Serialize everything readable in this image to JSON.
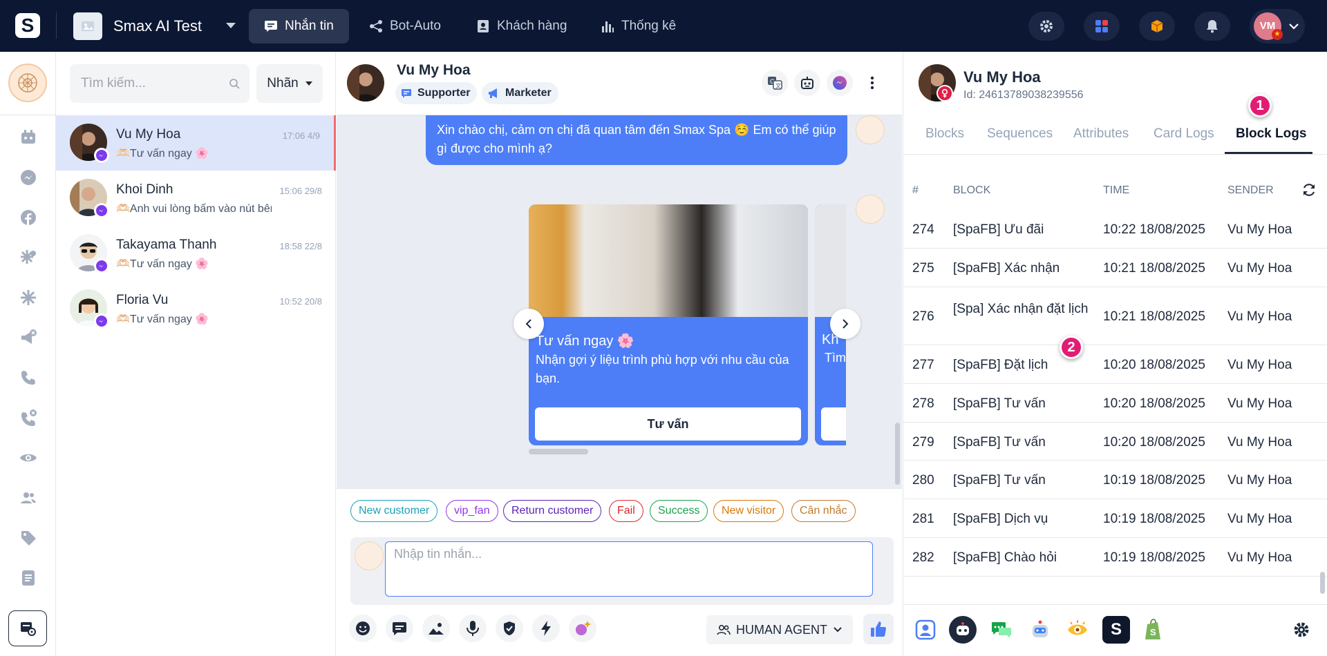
{
  "topbar": {
    "logo": "S",
    "workspace_name": "Smax AI Test",
    "tabs": [
      {
        "label": "Nhắn tin",
        "icon": "chat-icon",
        "active": true
      },
      {
        "label": "Bot-Auto",
        "icon": "bot-flow-icon",
        "active": false
      },
      {
        "label": "Khách hàng",
        "icon": "contact-icon",
        "active": false
      },
      {
        "label": "Thống kê",
        "icon": "stats-icon",
        "active": false
      }
    ],
    "avatar_initials": "VM",
    "flag_star": "★"
  },
  "left_rail": {
    "icons": [
      "bot-calendar-icon",
      "messenger-icon",
      "facebook-icon",
      "zalo-icon",
      "spark-icon",
      "megaphone-icon",
      "phone-icon",
      "phone-missed-icon",
      "eye-icon",
      "users-icon",
      "tag-icon",
      "document-icon",
      "workspace-settings-icon"
    ]
  },
  "conversation_list": {
    "search_placeholder": "Tìm kiếm...",
    "label_filter": "Nhãn",
    "items": [
      {
        "name": "Vu My Hoa",
        "preview": "🫶🏻Tư vấn ngay 🌸",
        "time": "17:06 4/9",
        "active": true
      },
      {
        "name": "Khoi Dinh",
        "preview": "🫶🏻Anh vui lòng bấm vào nút bên dưới",
        "time": "15:06 29/8",
        "active": false
      },
      {
        "name": "Takayama Thanh",
        "preview": "🫶🏻Tư vấn ngay 🌸",
        "time": "18:58 22/8",
        "active": false
      },
      {
        "name": "Floria Vu",
        "preview": "🫶🏻Tư vấn ngay 🌸",
        "time": "10:52 20/8",
        "active": false
      }
    ]
  },
  "chat": {
    "header": {
      "name": "Vu My Hoa",
      "tags": [
        {
          "label": "Supporter",
          "icon": "chat-bubble-icon"
        },
        {
          "label": "Marketer",
          "icon": "megaphone-icon"
        }
      ]
    },
    "message_text": "Xin chào chị, cảm ơn chị đã quan tâm đến Smax Spa ☺️ Em có thể giúp gì được cho mình ạ?",
    "card": {
      "title": "Tư vấn ngay 🌸",
      "subtitle": "Nhận gợi ý liệu trình phù hợp với nhu cầu của bạn.",
      "button": "Tư vấn"
    },
    "card2": {
      "title": "Kh",
      "subtitle": "Tìm"
    },
    "labels": [
      {
        "text": "New customer",
        "color": "#17a2b8"
      },
      {
        "text": "vip_fan",
        "color": "#9333ea"
      },
      {
        "text": "Return customer",
        "color": "#5b21b6"
      },
      {
        "text": "Fail",
        "color": "#dc2626"
      },
      {
        "text": "Success",
        "color": "#16a34a"
      },
      {
        "text": "New visitor",
        "color": "#d97706"
      },
      {
        "text": "Cân nhắc",
        "color": "#c2792b"
      }
    ],
    "composer_placeholder": "Nhập tin nhắn...",
    "agent_mode": "HUMAN AGENT"
  },
  "right_panel": {
    "name": "Vu My Hoa",
    "id_text": "Id: 24613789038239556",
    "tabs": [
      "Blocks",
      "Sequences",
      "Attributes",
      "Card Logs",
      "Block Logs"
    ],
    "active_tab": "Block Logs",
    "markers": [
      "1",
      "2"
    ],
    "table": {
      "headers": [
        "#",
        "BLOCK",
        "TIME",
        "SENDER"
      ],
      "rows": [
        {
          "num": "274",
          "block": "[SpaFB] Ưu đãi",
          "time": "10:22 18/08/2025",
          "sender": "Vu My Hoa"
        },
        {
          "num": "275",
          "block": "[SpaFB] Xác nhận",
          "time": "10:21 18/08/2025",
          "sender": "Vu My Hoa"
        },
        {
          "num": "276",
          "block": "[Spa] Xác nhận đặt lịch",
          "time": "10:21 18/08/2025",
          "sender": "Vu My Hoa"
        },
        {
          "num": "277",
          "block": "[SpaFB] Đặt lịch",
          "time": "10:20 18/08/2025",
          "sender": "Vu My Hoa"
        },
        {
          "num": "278",
          "block": "[SpaFB] Tư vấn",
          "time": "10:20 18/08/2025",
          "sender": "Vu My Hoa"
        },
        {
          "num": "279",
          "block": "[SpaFB] Tư vấn",
          "time": "10:20 18/08/2025",
          "sender": "Vu My Hoa"
        },
        {
          "num": "280",
          "block": "[SpaFB] Tư vấn",
          "time": "10:19 18/08/2025",
          "sender": "Vu My Hoa"
        },
        {
          "num": "281",
          "block": "[SpaFB] Dịch vụ",
          "time": "10:19 18/08/2025",
          "sender": "Vu My Hoa"
        },
        {
          "num": "282",
          "block": "[SpaFB] Chào hỏi",
          "time": "10:19 18/08/2025",
          "sender": "Vu My Hoa"
        }
      ]
    },
    "bottom_apps": [
      "profile-app-icon",
      "ai-bot-app-icon",
      "chat-app-icon",
      "robot-app-icon",
      "eye-app-icon",
      "smax-app-icon",
      "shopify-app-icon",
      "settings-icon"
    ],
    "bottom_logo": "S"
  }
}
